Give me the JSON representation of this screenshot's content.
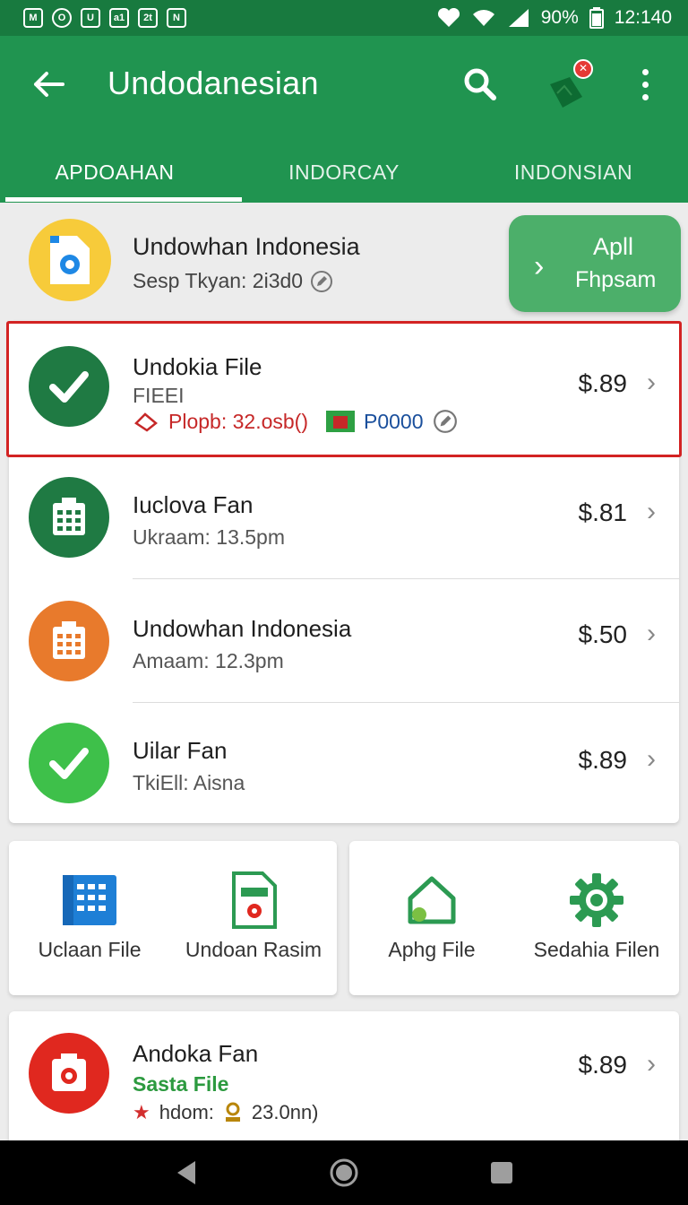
{
  "status_bar": {
    "app_icons": [
      "M",
      "O",
      "U",
      "a1",
      "2t",
      "N"
    ],
    "battery": "90%",
    "time": "12:140"
  },
  "appbar": {
    "title": "Undodanesian",
    "notification_badge": "✕"
  },
  "tabs": [
    {
      "label": "APDOAHAN",
      "selected": true
    },
    {
      "label": "INDORCAY",
      "selected": false
    },
    {
      "label": "INDONSIAN",
      "selected": false
    }
  ],
  "featured": {
    "title": "Undowhan Indonesia",
    "subtitle": "Sesp Tkyan: 2i3d0",
    "apply_line1": "Apll",
    "apply_line2": "Fhpsam"
  },
  "list": [
    {
      "title": "Undokia File",
      "subtitle": "FIEEI",
      "detail_red": "Plopb: 32.osb()",
      "detail_blue": "P0000",
      "price": "$.89",
      "icon": "check-icon",
      "icon_color": "#1f7a43",
      "selected": true
    },
    {
      "title": "Iuclova Fan",
      "subtitle": "Ukraam: 13.5pm",
      "price": "$.81",
      "icon": "calendar-icon",
      "icon_color": "#1f7a43"
    },
    {
      "title": "Undowhan Indonesia",
      "subtitle": "Amaam: 12.3pm",
      "price": "$.50",
      "icon": "calendar-icon",
      "icon_color": "#e87a2c"
    },
    {
      "title": "Uilar Fan",
      "subtitle": "TkiEll: Aisna",
      "price": "$.89",
      "icon": "check-icon",
      "icon_color": "#3ec04a"
    }
  ],
  "grid_left": [
    {
      "label": "Uclaan File",
      "icon": "grid-file-icon",
      "color": "#1e7fd6"
    },
    {
      "label": "Undoan Rasim",
      "icon": "document-icon",
      "color": "#2c9a52"
    }
  ],
  "grid_right": [
    {
      "label": "Aphg File",
      "icon": "home-icon",
      "color": "#2c9a52"
    },
    {
      "label": "Sedahia Filen",
      "icon": "gear-icon",
      "color": "#2c9a52"
    }
  ],
  "bottom_item": {
    "title": "Andoka Fan",
    "subtitle": "Sasta File",
    "detail": "hdom:",
    "detail_value": "23.0nn)",
    "price": "$.89",
    "icon": "camera-icon",
    "icon_color": "#e0281f"
  },
  "colors": {
    "primary": "#209450",
    "status_bar": "#187a3f",
    "highlight": "#d32323",
    "accent_green": "#4caf6a"
  }
}
